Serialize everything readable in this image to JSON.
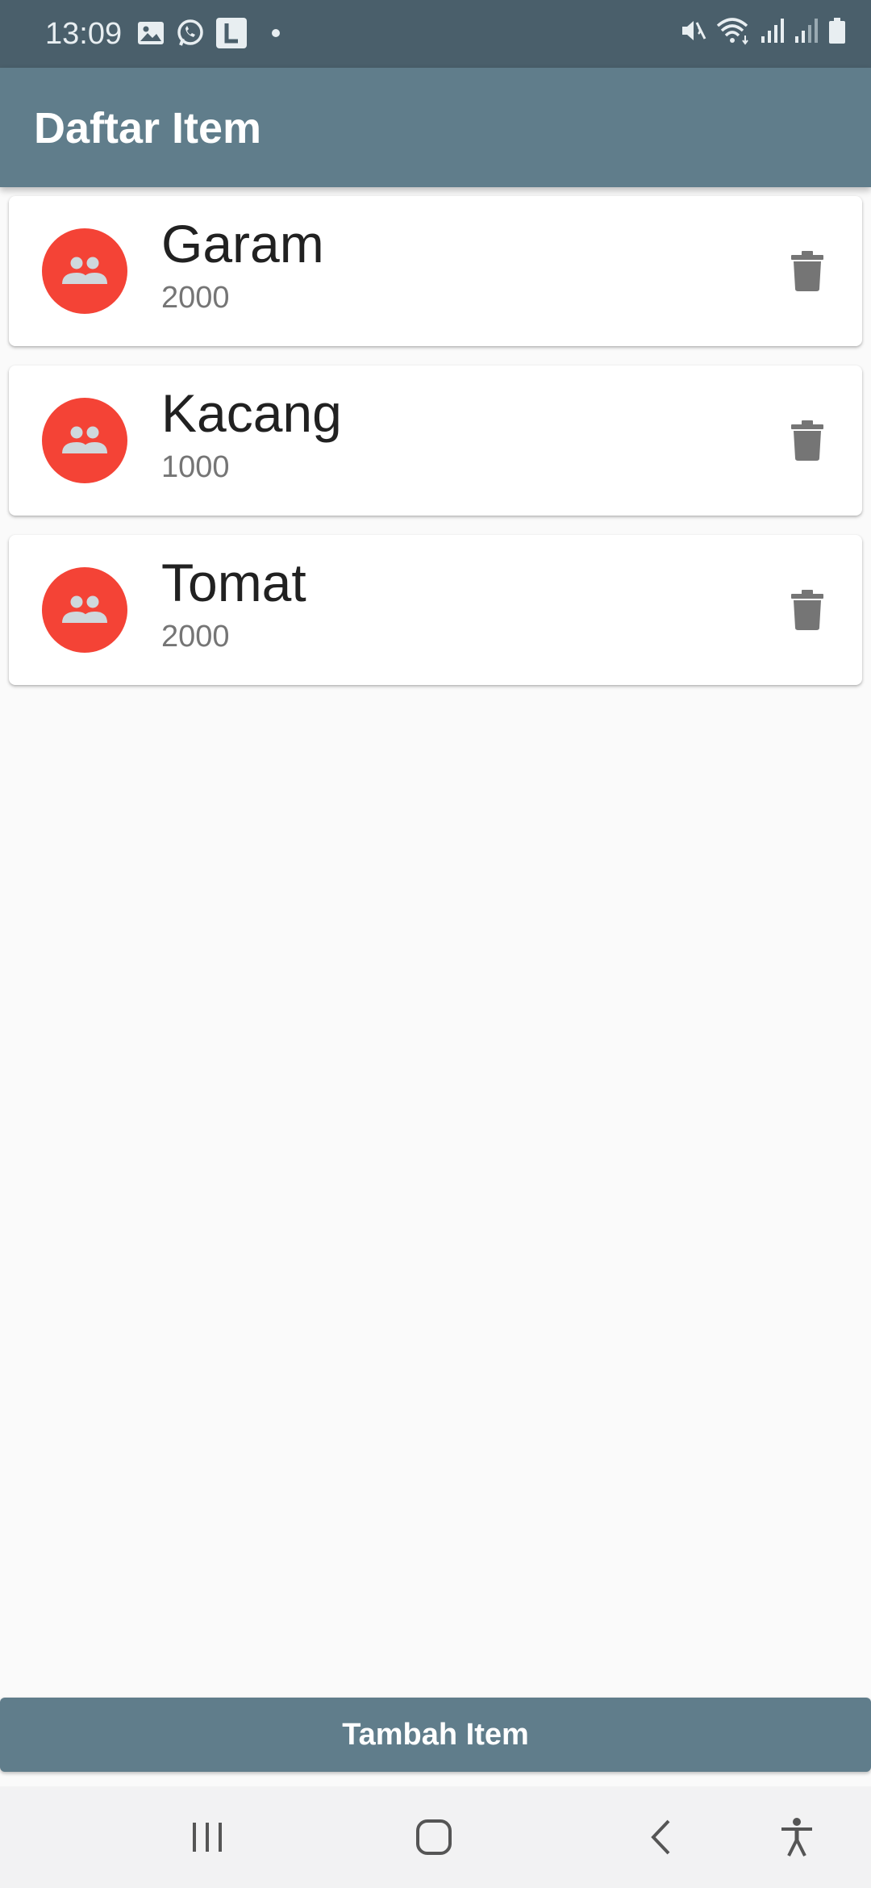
{
  "status_bar": {
    "time": "13:09",
    "left_icons": [
      "gallery-icon",
      "whatsapp-icon",
      "l-app-icon",
      "notification-dot-icon"
    ],
    "right_icons": [
      "mute-icon",
      "wifi-icon",
      "signal-icon",
      "signal-icon",
      "battery-icon"
    ]
  },
  "app_bar": {
    "title": "Daftar Item"
  },
  "items": [
    {
      "name": "Garam",
      "price": "2000"
    },
    {
      "name": "Kacang",
      "price": "1000"
    },
    {
      "name": "Tomat",
      "price": "2000"
    }
  ],
  "add_button": {
    "label": "Tambah Item"
  },
  "nav_bar": {
    "icons": [
      "recent-apps-icon",
      "home-icon",
      "back-icon",
      "accessibility-icon"
    ]
  },
  "colors": {
    "status_bar": "#4a5f6b",
    "primary": "#607d8b",
    "avatar": "#f44336",
    "avatar_icon": "#cfd8dc",
    "delete_icon": "#757575",
    "background": "#fafafa"
  }
}
